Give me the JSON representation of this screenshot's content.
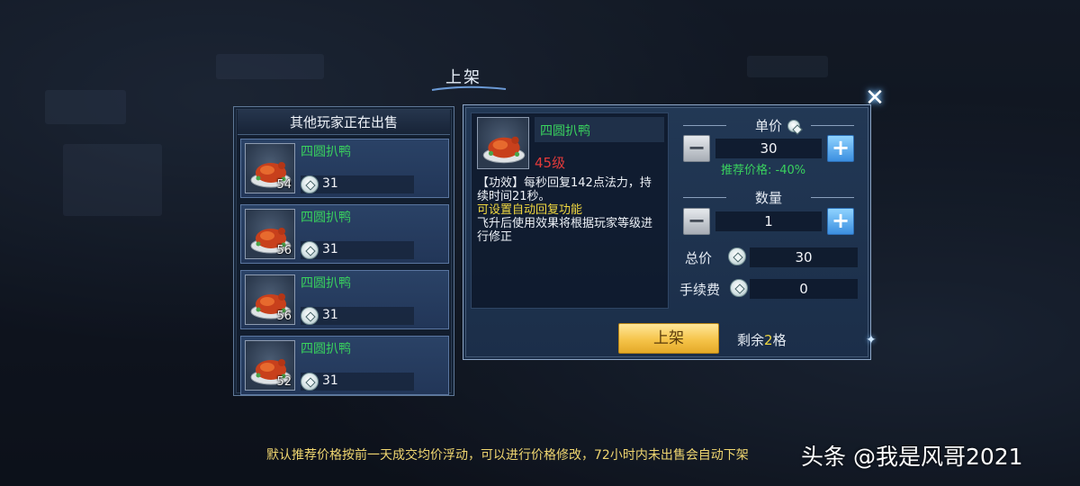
{
  "window": {
    "title": "上架",
    "close_icon": "close-icon"
  },
  "sellers": {
    "header": "其他玩家正在出售",
    "items": [
      {
        "name": "四圆扒鸭",
        "level": "54",
        "price": "31"
      },
      {
        "name": "四圆扒鸭",
        "level": "56",
        "price": "31"
      },
      {
        "name": "四圆扒鸭",
        "level": "56",
        "price": "31"
      },
      {
        "name": "四圆扒鸭",
        "level": "52",
        "price": "31"
      }
    ]
  },
  "item": {
    "name": "四圆扒鸭",
    "level": "45级",
    "desc_main": "【功效】每秒回复142点法力，持续时间21秒。",
    "desc_auto": "可设置自动回复功能",
    "desc_extra": "飞升后使用效果将根据玩家等级进行修正"
  },
  "unit_price": {
    "label": "单价",
    "value": "30",
    "recommend": "推荐价格: -40%",
    "minus": "−",
    "plus": "+"
  },
  "quantity": {
    "label": "数量",
    "value": "1",
    "minus": "−",
    "plus": "+"
  },
  "total": {
    "label": "总价",
    "value": "30"
  },
  "fee": {
    "label": "手续费",
    "value": "0"
  },
  "actions": {
    "list_label": "上架",
    "slots_prefix": "剩余",
    "slots_count": "2",
    "slots_suffix": "格"
  },
  "footer": {
    "note": "默认推荐价格按前一天成交均价浮动，可以进行价格修改，72小时内未出售会自动下架"
  },
  "watermark": "头条 @我是风哥2021",
  "colors": {
    "item_name": "#39d25e",
    "level_red": "#e43a3a",
    "highlight_yellow": "#f1d840",
    "button_gold": "#f5c44a",
    "plus_blue": "#3b8fe0"
  }
}
